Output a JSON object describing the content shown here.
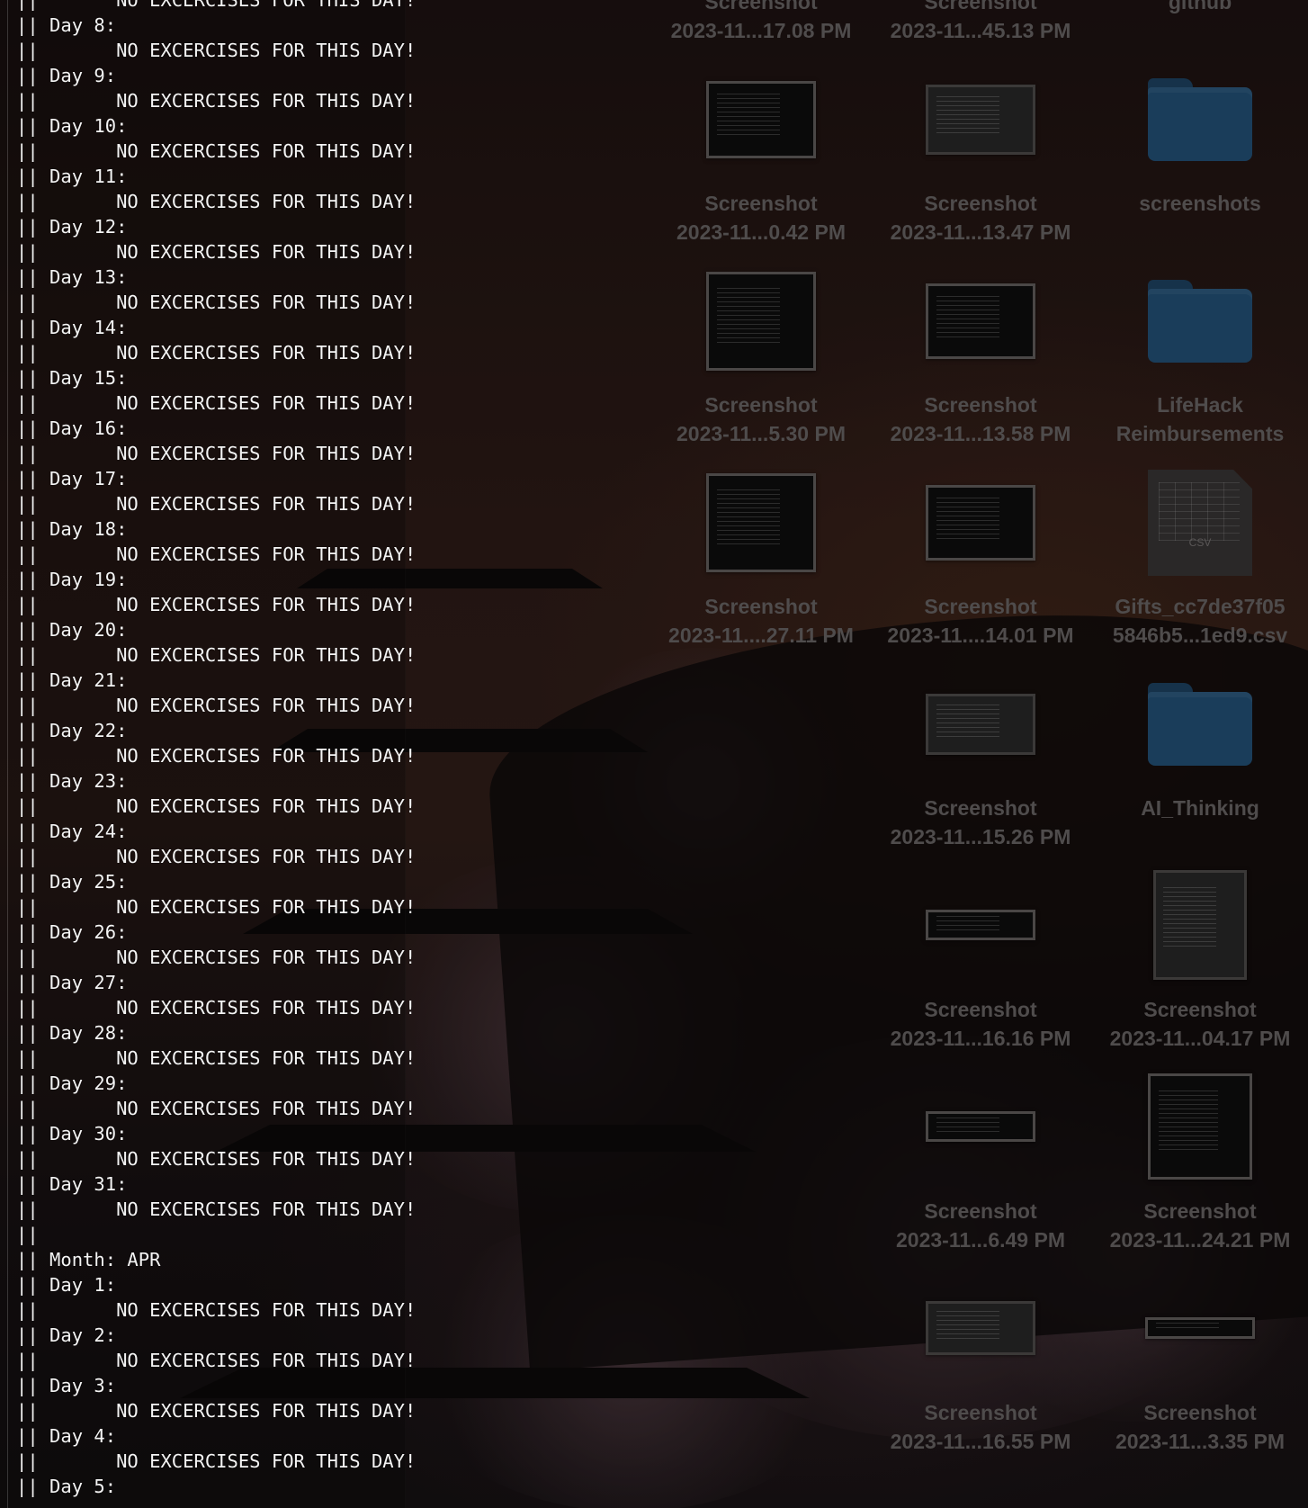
{
  "terminal": {
    "lines": [
      "||       NO EXCERCISES FOR THIS DAY!",
      "|| Day 8:",
      "||       NO EXCERCISES FOR THIS DAY!",
      "|| Day 9:",
      "||       NO EXCERCISES FOR THIS DAY!",
      "|| Day 10:",
      "||       NO EXCERCISES FOR THIS DAY!",
      "|| Day 11:",
      "||       NO EXCERCISES FOR THIS DAY!",
      "|| Day 12:",
      "||       NO EXCERCISES FOR THIS DAY!",
      "|| Day 13:",
      "||       NO EXCERCISES FOR THIS DAY!",
      "|| Day 14:",
      "||       NO EXCERCISES FOR THIS DAY!",
      "|| Day 15:",
      "||       NO EXCERCISES FOR THIS DAY!",
      "|| Day 16:",
      "||       NO EXCERCISES FOR THIS DAY!",
      "|| Day 17:",
      "||       NO EXCERCISES FOR THIS DAY!",
      "|| Day 18:",
      "||       NO EXCERCISES FOR THIS DAY!",
      "|| Day 19:",
      "||       NO EXCERCISES FOR THIS DAY!",
      "|| Day 20:",
      "||       NO EXCERCISES FOR THIS DAY!",
      "|| Day 21:",
      "||       NO EXCERCISES FOR THIS DAY!",
      "|| Day 22:",
      "||       NO EXCERCISES FOR THIS DAY!",
      "|| Day 23:",
      "||       NO EXCERCISES FOR THIS DAY!",
      "|| Day 24:",
      "||       NO EXCERCISES FOR THIS DAY!",
      "|| Day 25:",
      "||       NO EXCERCISES FOR THIS DAY!",
      "|| Day 26:",
      "||       NO EXCERCISES FOR THIS DAY!",
      "|| Day 27:",
      "||       NO EXCERCISES FOR THIS DAY!",
      "|| Day 28:",
      "||       NO EXCERCISES FOR THIS DAY!",
      "|| Day 29:",
      "||       NO EXCERCISES FOR THIS DAY!",
      "|| Day 30:",
      "||       NO EXCERCISES FOR THIS DAY!",
      "|| Day 31:",
      "||       NO EXCERCISES FOR THIS DAY!",
      "||",
      "|| Month: APR",
      "|| Day 1:",
      "||       NO EXCERCISES FOR THIS DAY!",
      "|| Day 2:",
      "||       NO EXCERCISES FOR THIS DAY!",
      "|| Day 3:",
      "||       NO EXCERCISES FOR THIS DAY!",
      "|| Day 4:",
      "||       NO EXCERCISES FOR THIS DAY!",
      "|| Day 5:"
    ]
  },
  "desktop": {
    "items": [
      {
        "kind": "screenshot",
        "line1": "Screenshot",
        "line2": "2023-11...17.08 PM"
      },
      {
        "kind": "screenshot",
        "line1": "Screenshot",
        "line2": "2023-11...45.13 PM"
      },
      {
        "kind": "folder",
        "line1": "github",
        "line2": ""
      },
      {
        "kind": "screenshot",
        "line1": "Screenshot",
        "line2": "2023-11...0.42 PM"
      },
      {
        "kind": "screenshot",
        "line1": "Screenshot",
        "line2": "2023-11...13.47 PM"
      },
      {
        "kind": "folder",
        "line1": "screenshots",
        "line2": ""
      },
      {
        "kind": "screenshot",
        "line1": "Screenshot",
        "line2": "2023-11...5.30 PM"
      },
      {
        "kind": "screenshot",
        "line1": "Screenshot",
        "line2": "2023-11...13.58 PM"
      },
      {
        "kind": "folder",
        "line1": "LifeHack",
        "line2": "Reimbursements"
      },
      {
        "kind": "screenshot",
        "line1": "Screenshot",
        "line2": "2023-11....27.11 PM"
      },
      {
        "kind": "screenshot",
        "line1": "Screenshot",
        "line2": "2023-11....14.01 PM"
      },
      {
        "kind": "csv",
        "tag": "CSV",
        "line1": "Gifts_cc7de37f05",
        "line2": "5846b5...1ed9.csv"
      },
      {
        "kind": "screenshot",
        "line1": "Screenshot",
        "line2": "2023-11...15.26 PM"
      },
      {
        "kind": "folder",
        "line1": "AI_Thinking",
        "line2": ""
      },
      {
        "kind": "screenshot",
        "line1": "Screenshot",
        "line2": "2023-11...16.16 PM"
      },
      {
        "kind": "screenshot",
        "line1": "Screenshot",
        "line2": "2023-11...04.17 PM"
      },
      {
        "kind": "screenshot",
        "line1": "Screenshot",
        "line2": "2023-11...6.49 PM"
      },
      {
        "kind": "screenshot",
        "line1": "Screenshot",
        "line2": "2023-11...24.21 PM"
      },
      {
        "kind": "screenshot",
        "line1": "Screenshot",
        "line2": "2023-11...16.55 PM"
      },
      {
        "kind": "screenshot",
        "line1": "Screenshot",
        "line2": "2023-11...3.35 PM"
      }
    ]
  }
}
